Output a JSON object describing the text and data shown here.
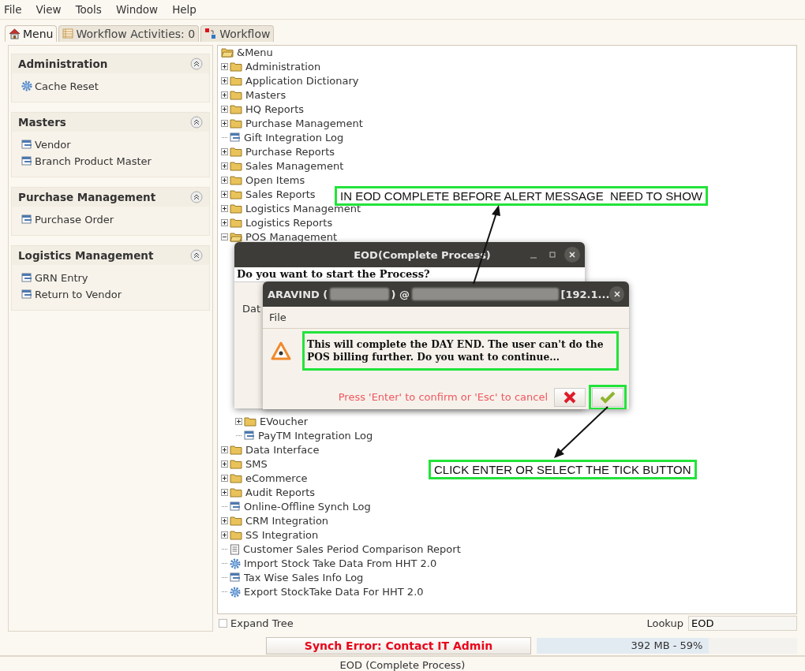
{
  "menu_bar": [
    "File",
    "View",
    "Tools",
    "Window",
    "Help"
  ],
  "tabs": [
    {
      "label": "Menu",
      "kind": "home",
      "selected": true
    },
    {
      "label": "Workflow Activities: 0",
      "kind": "table",
      "selected": false
    },
    {
      "label": "Workflow",
      "kind": "flow",
      "selected": false
    }
  ],
  "sidebar": {
    "sections": [
      {
        "title": "Administration",
        "items": [
          {
            "label": "Cache Reset",
            "kind": "process"
          }
        ]
      },
      {
        "title": "Masters",
        "items": [
          {
            "label": "Vendor",
            "kind": "window"
          },
          {
            "label": "Branch Product Master",
            "kind": "window"
          }
        ]
      },
      {
        "title": "Purchase Management",
        "items": [
          {
            "label": "Purchase Order",
            "kind": "window"
          }
        ]
      },
      {
        "title": "Logistics Management",
        "items": [
          {
            "label": "GRN Entry",
            "kind": "window"
          },
          {
            "label": "Return to Vendor",
            "kind": "window"
          }
        ]
      }
    ]
  },
  "tree": {
    "root": "&Menu",
    "items": [
      {
        "label": "Administration",
        "kind": "folder",
        "expanded": false
      },
      {
        "label": "Application Dictionary",
        "kind": "folder",
        "expanded": false
      },
      {
        "label": "Masters",
        "kind": "folder",
        "expanded": false
      },
      {
        "label": "HQ Reports",
        "kind": "folder",
        "expanded": false
      },
      {
        "label": "Purchase Management",
        "kind": "folder",
        "expanded": false
      },
      {
        "label": "Gift Integration Log",
        "kind": "window"
      },
      {
        "label": "Purchase Reports",
        "kind": "folder",
        "expanded": false
      },
      {
        "label": "Sales Management",
        "kind": "folder",
        "expanded": false
      },
      {
        "label": "Open Items",
        "kind": "folder",
        "expanded": false
      },
      {
        "label": "Sales Reports",
        "kind": "folder",
        "expanded": false
      },
      {
        "label": "Logistics Management",
        "kind": "folder",
        "expanded": false
      },
      {
        "label": "Logistics Reports",
        "kind": "folder",
        "expanded": false
      },
      {
        "label": "POS Management",
        "kind": "folder",
        "expanded": true,
        "children": [
          {
            "label": "EVoucher",
            "kind": "folder",
            "expanded": false
          },
          {
            "label": "PayTM Integration Log",
            "kind": "window"
          }
        ]
      },
      {
        "label": "Data Interface",
        "kind": "folder",
        "expanded": false
      },
      {
        "label": "SMS",
        "kind": "folder",
        "expanded": false
      },
      {
        "label": "eCommerce",
        "kind": "folder",
        "expanded": false
      },
      {
        "label": "Audit Reports",
        "kind": "folder",
        "expanded": false
      },
      {
        "label": "Online-Offline Synch Log",
        "kind": "window"
      },
      {
        "label": "CRM Integration",
        "kind": "folder",
        "expanded": false
      },
      {
        "label": "SS Integration",
        "kind": "folder",
        "expanded": false
      },
      {
        "label": "Customer Sales Period Comparison Report",
        "kind": "report"
      },
      {
        "label": "Import Stock Take Data From HHT 2.0",
        "kind": "process"
      },
      {
        "label": "Tax Wise Sales Info Log",
        "kind": "window"
      },
      {
        "label": "Export StockTake Data For HHT 2.0",
        "kind": "process"
      }
    ]
  },
  "expand_tree": {
    "label": "Expand Tree",
    "checked": false
  },
  "lookup": {
    "label": "Lookup",
    "value": "EOD"
  },
  "status": {
    "error": "Synch Error: Contact IT Admin",
    "memory": {
      "text": "392 MB - 59%",
      "level": 0.66
    }
  },
  "footer_title": "EOD (Complete Process)",
  "eod_dialog": {
    "title": "EOD(Complete Process)",
    "question": "Do you want to start the Process?",
    "field_label": "Dat"
  },
  "alert_dialog": {
    "title_parts": [
      "ARAVIND (",
      ") @",
      "[192.1..."
    ],
    "menu": [
      "File"
    ],
    "message": "This will complete the DAY END. The user can't do the POS billing further. Do you want to continue...",
    "hint": "Press 'Enter' to confirm or 'Esc' to cancel"
  },
  "annotations": [
    {
      "text": "IN EOD COMPLETE BEFORE ALERT MESSAGE  NEED TO SHOW"
    },
    {
      "text": "CLICK ENTER OR SELECT THE TICK BUTTON"
    }
  ]
}
